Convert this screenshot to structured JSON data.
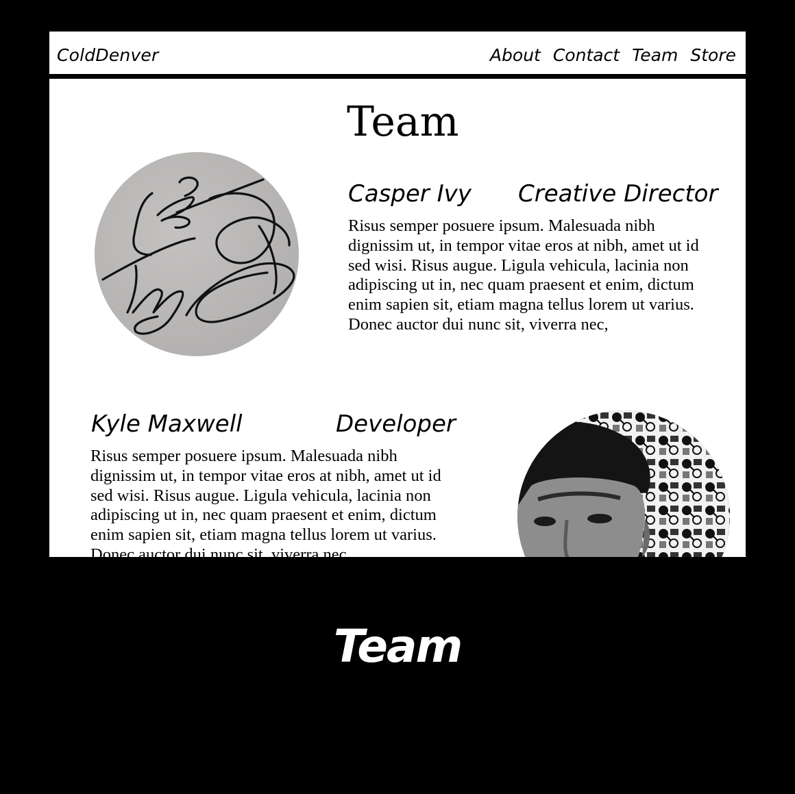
{
  "header": {
    "brand": "ColdDenver",
    "nav": [
      "About",
      "Contact",
      "Team",
      "Store"
    ]
  },
  "page": {
    "title": "Team"
  },
  "members": [
    {
      "name": "Casper Ivy",
      "role": "Creative Director",
      "bio": "Risus semper posuere ipsum. Malesuada nibh dignissim ut, in tempor vitae eros at nibh, amet ut id sed wisi. Risus augue. Ligula vehicula, lacinia non adipiscing ut in, nec quam praesent et enim, dictum enim sapien sit, etiam magna tellus lorem ut varius. Donec auctor dui nunc sit, viverra nec,"
    },
    {
      "name": "Kyle Maxwell",
      "role": "Developer",
      "bio": "Risus semper posuere ipsum. Malesuada nibh dignissim ut, in tempor vitae eros at nibh, amet ut id sed wisi. Risus augue. Ligula vehicula, lacinia non adipiscing ut in, nec quam praesent et enim, dictum enim sapien sit, etiam magna tellus lorem ut varius. Donec auctor dui nunc sit, viverra nec,"
    }
  ],
  "caption": "Team"
}
